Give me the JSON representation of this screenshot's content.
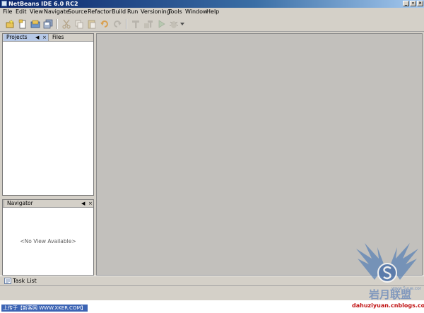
{
  "window": {
    "title": "NetBeans IDE 6.0 RC2",
    "controls": {
      "minimize": "_",
      "maximize": "▫",
      "close": "×"
    }
  },
  "menubar": {
    "items": [
      "File",
      "Edit",
      "View",
      "Navigate",
      "Source",
      "Refactor",
      "Build",
      "Run",
      "Versioning",
      "Tools",
      "Window",
      "Help"
    ]
  },
  "toolbar": {
    "icons": [
      "new-project-icon",
      "new-file-icon",
      "open-project-icon",
      "save-all-icon",
      "cut-icon",
      "copy-icon",
      "paste-icon",
      "undo-icon",
      "redo-icon",
      "build-icon",
      "clean-build-icon",
      "run-icon",
      "debug-icon",
      "dropdown-arrow-icon"
    ]
  },
  "projects_panel": {
    "tabs": [
      "Projects",
      "Files"
    ],
    "active_tab": "Projects",
    "controls": {
      "minimize": "◀",
      "close": "×"
    }
  },
  "navigator_panel": {
    "title": "Navigator",
    "empty_message": "<No View Available>",
    "controls": {
      "minimize": "◀",
      "close": "×"
    }
  },
  "task_list": {
    "label": "Task List"
  },
  "footer": {
    "upload_note": "上传于【新客网 WWW.XKER.COM】",
    "watermark_url": "dahuziyuan.cnblogs.com"
  },
  "colors": {
    "title_bar": "#0a246a",
    "chrome": "#d4d0c8",
    "editor_bg": "#c2c0bc",
    "active_tab": "#b6c8e6",
    "watermark": "#c01010"
  }
}
